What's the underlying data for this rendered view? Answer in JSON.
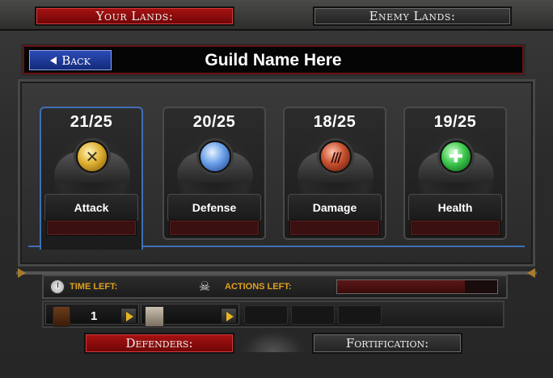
{
  "top_tabs": {
    "your_lands": "Your Lands:",
    "enemy_lands": "Enemy Lands:"
  },
  "header": {
    "back_label": "Back",
    "guild_name": "Guild Name Here"
  },
  "stats": [
    {
      "count": "21/25",
      "label": "Attack",
      "icon": "attack-orb-icon",
      "fill": 0,
      "selected": true
    },
    {
      "count": "20/25",
      "label": "Defense",
      "icon": "defense-orb-icon",
      "fill": 0,
      "selected": false
    },
    {
      "count": "18/25",
      "label": "Damage",
      "icon": "damage-orb-icon",
      "fill": 0,
      "selected": false
    },
    {
      "count": "19/25",
      "label": "Health",
      "icon": "health-orb-icon",
      "fill": 0,
      "selected": false
    }
  ],
  "info": {
    "time_left_label": "TIME LEFT:",
    "actions_left_label": "ACTIONS LEFT:",
    "actions_fill_pct": 80
  },
  "units": {
    "soldier_count": "1"
  },
  "bottom_tabs": {
    "defenders": "Defenders:",
    "fortification": "Fortification:"
  },
  "colors": {
    "accent_red": "#a81212",
    "selection_blue": "#3f6fb8",
    "label_gold": "#e0a020",
    "back_blue": "#2b4bb6"
  }
}
